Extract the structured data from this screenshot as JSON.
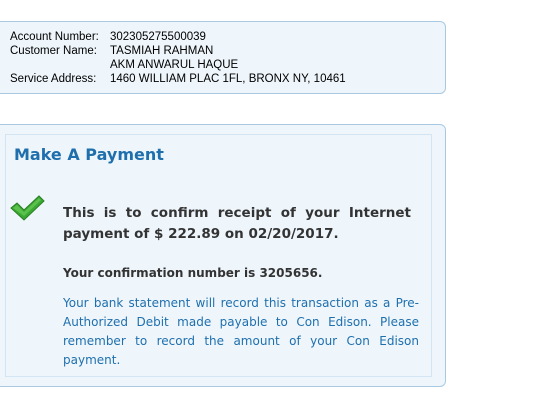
{
  "account": {
    "number_label": "Account Number:",
    "number_value": "302305275500039",
    "customer_label": "Customer Name:",
    "customer_name_1": "TASMIAH RAHMAN",
    "customer_name_2": "AKM ANWARUL HAQUE",
    "address_label": "Service Address:",
    "address_value": "1460 WILLIAM PLAC 1FL, BRONX NY, 10461"
  },
  "payment": {
    "title": "Make A Payment",
    "icon": "green-checkmark-icon",
    "confirmation_text": "This is to confirm receipt of your Internet payment of $ 222.89 on 02/20/2017.",
    "confirmation_number_text": "Your confirmation number is 3205656.",
    "note_text": "Your bank statement will record this transaction as a Pre-Authorized Debit made payable to Con Edison. Please remember to record the amount of your Con Edison payment."
  },
  "colors": {
    "panel_bg": "#eef6fc",
    "panel_border": "#a9c9e2",
    "title_blue": "#1f6fad",
    "check_green": "#3aa832"
  }
}
